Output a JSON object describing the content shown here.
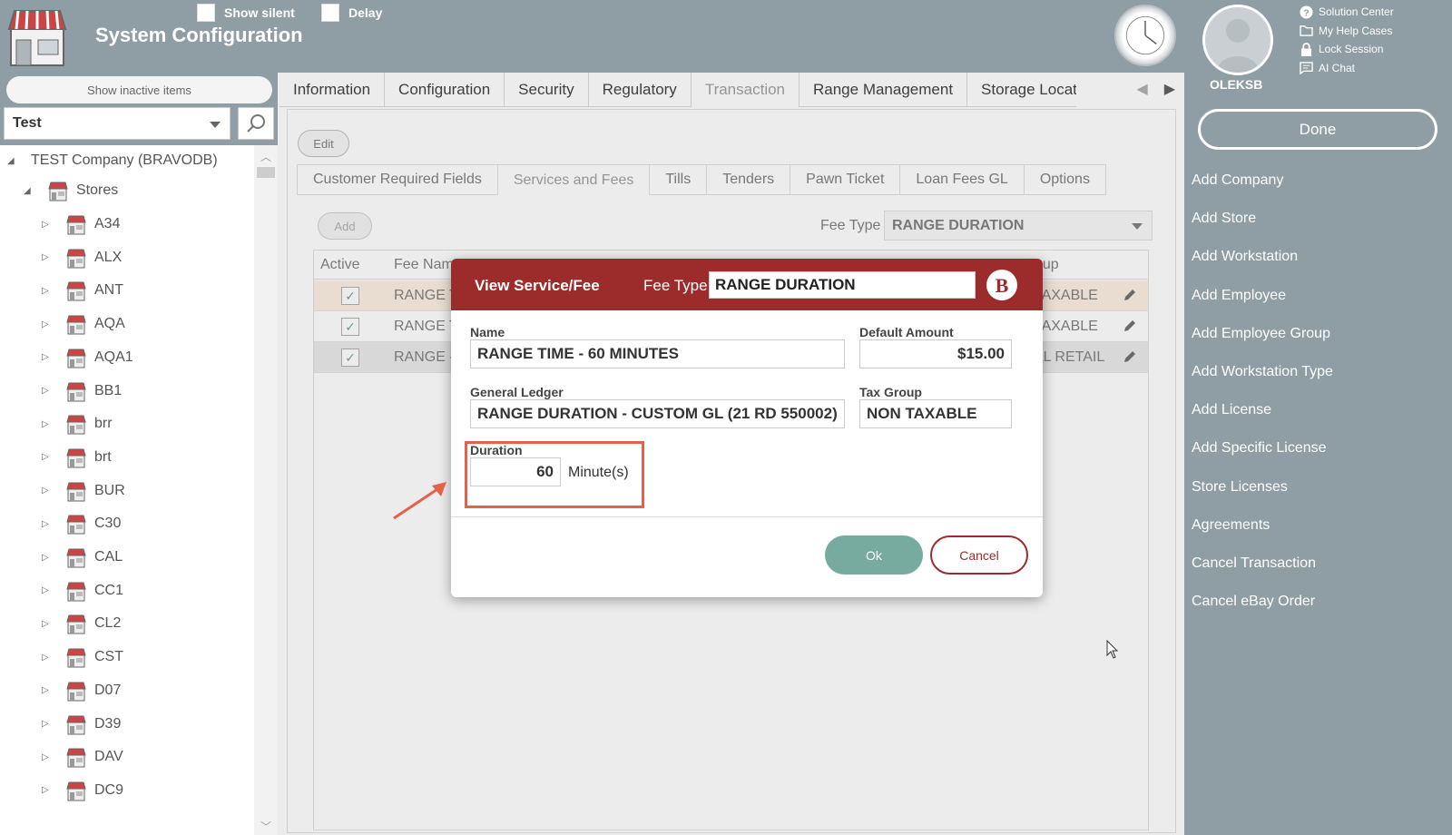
{
  "header": {
    "title": "System Configuration",
    "show_silent_label": "Show silent",
    "delay_label": "Delay"
  },
  "user": {
    "name": "OLEKSB",
    "links": [
      {
        "label": "Solution Center",
        "icon": "help-circle-icon"
      },
      {
        "label": "My Help Cases",
        "icon": "folder-icon"
      },
      {
        "label": "Lock Session",
        "icon": "lock-icon"
      },
      {
        "label": "AI Chat",
        "icon": "chat-icon"
      }
    ]
  },
  "right_panel": {
    "done_label": "Done",
    "actions": [
      "Add Company",
      "Add Store",
      "Add Workstation",
      "Add Employee",
      "Add Employee Group",
      "Add Workstation Type",
      "Add License",
      "Add Specific License",
      "Store Licenses",
      "Agreements",
      "Cancel Transaction",
      "Cancel eBay Order"
    ]
  },
  "sidebar": {
    "show_inactive_label": "Show inactive items",
    "store_select_value": "Test",
    "company": "TEST Company (BRAVODB)",
    "stores_label": "Stores",
    "stores": [
      "A34",
      "ALX",
      "ANT",
      "AQA",
      "AQA1",
      "BB1",
      "brr",
      "brt",
      "BUR",
      "C30",
      "CAL",
      "CC1",
      "CL2",
      "CST",
      "D07",
      "D39",
      "DAV",
      "DC9"
    ]
  },
  "main": {
    "tabs": [
      "Information",
      "Configuration",
      "Security",
      "Regulatory",
      "Transaction",
      "Range Management",
      "Storage Locati"
    ],
    "active_tab": "Transaction",
    "edit_label": "Edit",
    "sub_tabs": [
      "Customer Required Fields",
      "Services and Fees",
      "Tills",
      "Tenders",
      "Pawn Ticket",
      "Loan Fees GL",
      "Options"
    ],
    "active_sub_tab": "Services and Fees",
    "add_label": "Add",
    "fee_type_label": "Fee Type",
    "fee_type_value": "RANGE DURATION",
    "grid": {
      "col_active": "Active",
      "col_fee_name": "Fee Name",
      "col_group_partial": "oup",
      "rows": [
        {
          "fee_name": "RANGE TI",
          "tax": "TAXABLE",
          "checked": true
        },
        {
          "fee_name": "RANGE TI",
          "tax": "TAXABLE",
          "checked": true
        },
        {
          "fee_name": "RANGE -",
          "tax": "AL RETAIL",
          "checked": true
        }
      ]
    }
  },
  "dialog": {
    "title": "View Service/Fee",
    "fee_type_label": "Fee Type",
    "fee_type_value": "RANGE DURATION",
    "name_label": "Name",
    "name_value": "RANGE TIME - 60 MINUTES",
    "default_amount_label": "Default Amount",
    "default_amount_value": "$15.00",
    "gl_label": "General Ledger",
    "gl_value": "RANGE DURATION - CUSTOM GL (21 RD 550002)",
    "tax_group_label": "Tax Group",
    "tax_group_value": "NON TAXABLE",
    "duration_label": "Duration",
    "duration_value": "60",
    "duration_unit": "Minute(s)",
    "ok_label": "Ok",
    "cancel_label": "Cancel"
  },
  "colors": {
    "accent_red": "#9c2b2b",
    "ok_green": "#78aba0",
    "highlight_orange": "#e4614a",
    "chrome_gray": "#8f9ea4"
  }
}
